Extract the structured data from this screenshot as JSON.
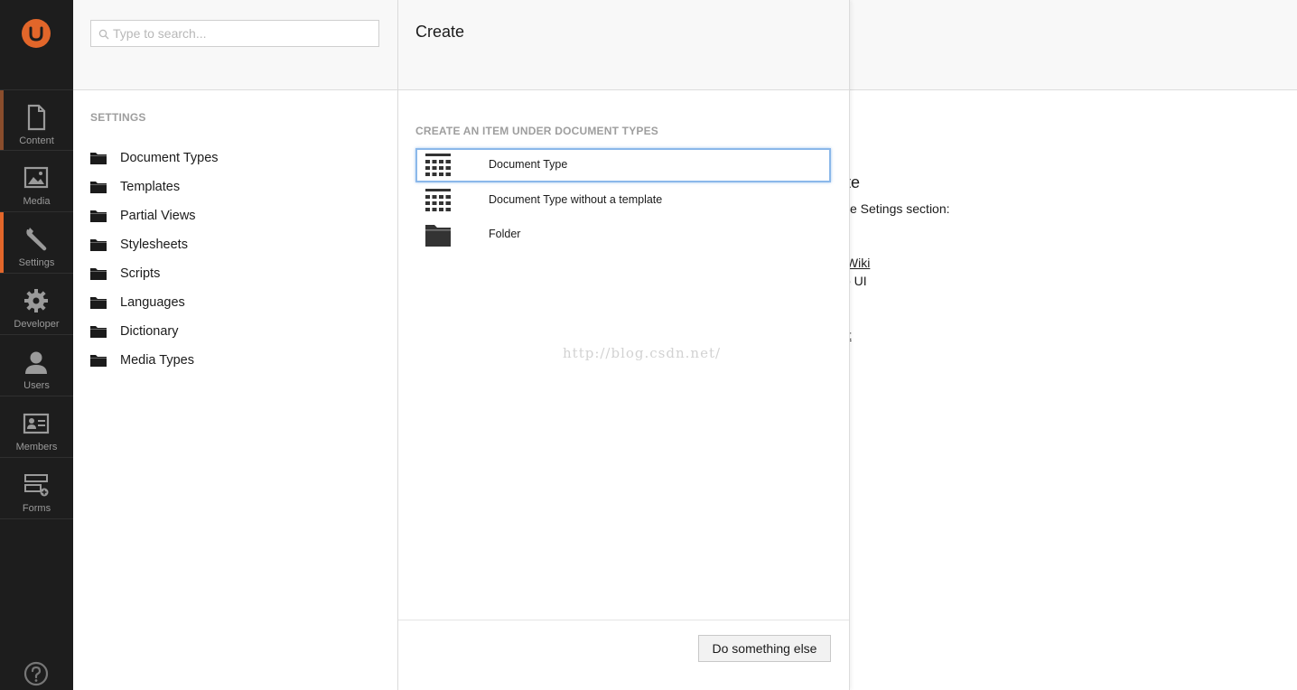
{
  "app_nav": {
    "items": [
      {
        "label": "Content",
        "icon": "document-icon"
      },
      {
        "label": "Media",
        "icon": "image-icon"
      },
      {
        "label": "Settings",
        "icon": "wrench-icon"
      },
      {
        "label": "Developer",
        "icon": "gear-icon"
      },
      {
        "label": "Users",
        "icon": "user-icon"
      },
      {
        "label": "Members",
        "icon": "id-card-icon"
      },
      {
        "label": "Forms",
        "icon": "form-icon"
      }
    ],
    "active": "Settings",
    "accent_color": "#e2662a"
  },
  "tree": {
    "search_placeholder": "Type to search...",
    "section_title": "SETTINGS",
    "items": [
      {
        "label": "Document Types"
      },
      {
        "label": "Templates"
      },
      {
        "label": "Partial Views"
      },
      {
        "label": "Stylesheets"
      },
      {
        "label": "Scripts"
      },
      {
        "label": "Languages"
      },
      {
        "label": "Dictionary"
      },
      {
        "label": "Media Types"
      }
    ]
  },
  "dialog": {
    "title": "Create",
    "section_title": "CREATE AN ITEM UNDER DOCUMENT TYPES",
    "options": [
      {
        "label": "Document Type",
        "icon": "grid-icon",
        "selected": true
      },
      {
        "label": "Document Type without a template",
        "icon": "grid-icon",
        "selected": false
      },
      {
        "label": "Folder",
        "icon": "folder-icon",
        "selected": false
      }
    ],
    "footer_button": "Do something else",
    "watermark": "http://blog.csdn.net/"
  },
  "background": {
    "heading_fragment": "site",
    "line1_fragment": "e Setings section:",
    "link1_fragment": "y Wiki",
    "line2_fragment": "o UI",
    "line3_fragment": ")",
    "link2_fragment": "rt"
  }
}
